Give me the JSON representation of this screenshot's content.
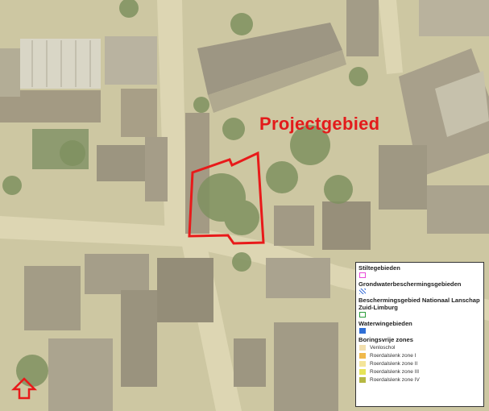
{
  "project_label": "Projectgebied",
  "legend": {
    "sections": [
      {
        "title": "Stiltegebieden",
        "swatch": "#e84ad8",
        "style": "outline"
      },
      {
        "title": "Grondwaterbeschermingsgebieden",
        "swatch": "#3a6fd8",
        "style": "hatch"
      },
      {
        "title": "Beschermingsgebied Nationaal Lanschap Zuid-Limburg",
        "swatch": "#2a9d3a",
        "style": "outline"
      },
      {
        "title": "Waterwingebieden",
        "swatch": "#2f6fd6",
        "style": "fill"
      }
    ],
    "borings": {
      "title": "Boringsvrije zones",
      "items": [
        {
          "label": "Venloschol",
          "color": "#f2dfae"
        },
        {
          "label": "Roerdalslenk zone I",
          "color": "#f0b94c"
        },
        {
          "label": "Roerdalslenk zone II",
          "color": "#f4e59a"
        },
        {
          "label": "Roerdalslenk zone III",
          "color": "#e6e457"
        },
        {
          "label": "Roerdalslenk zone IV",
          "color": "#b6b842"
        }
      ]
    }
  },
  "colors": {
    "boundary": "#e81a1a",
    "north_arrow": "#e81a1a"
  },
  "icons": {
    "north_arrow": "north-arrow-icon"
  }
}
